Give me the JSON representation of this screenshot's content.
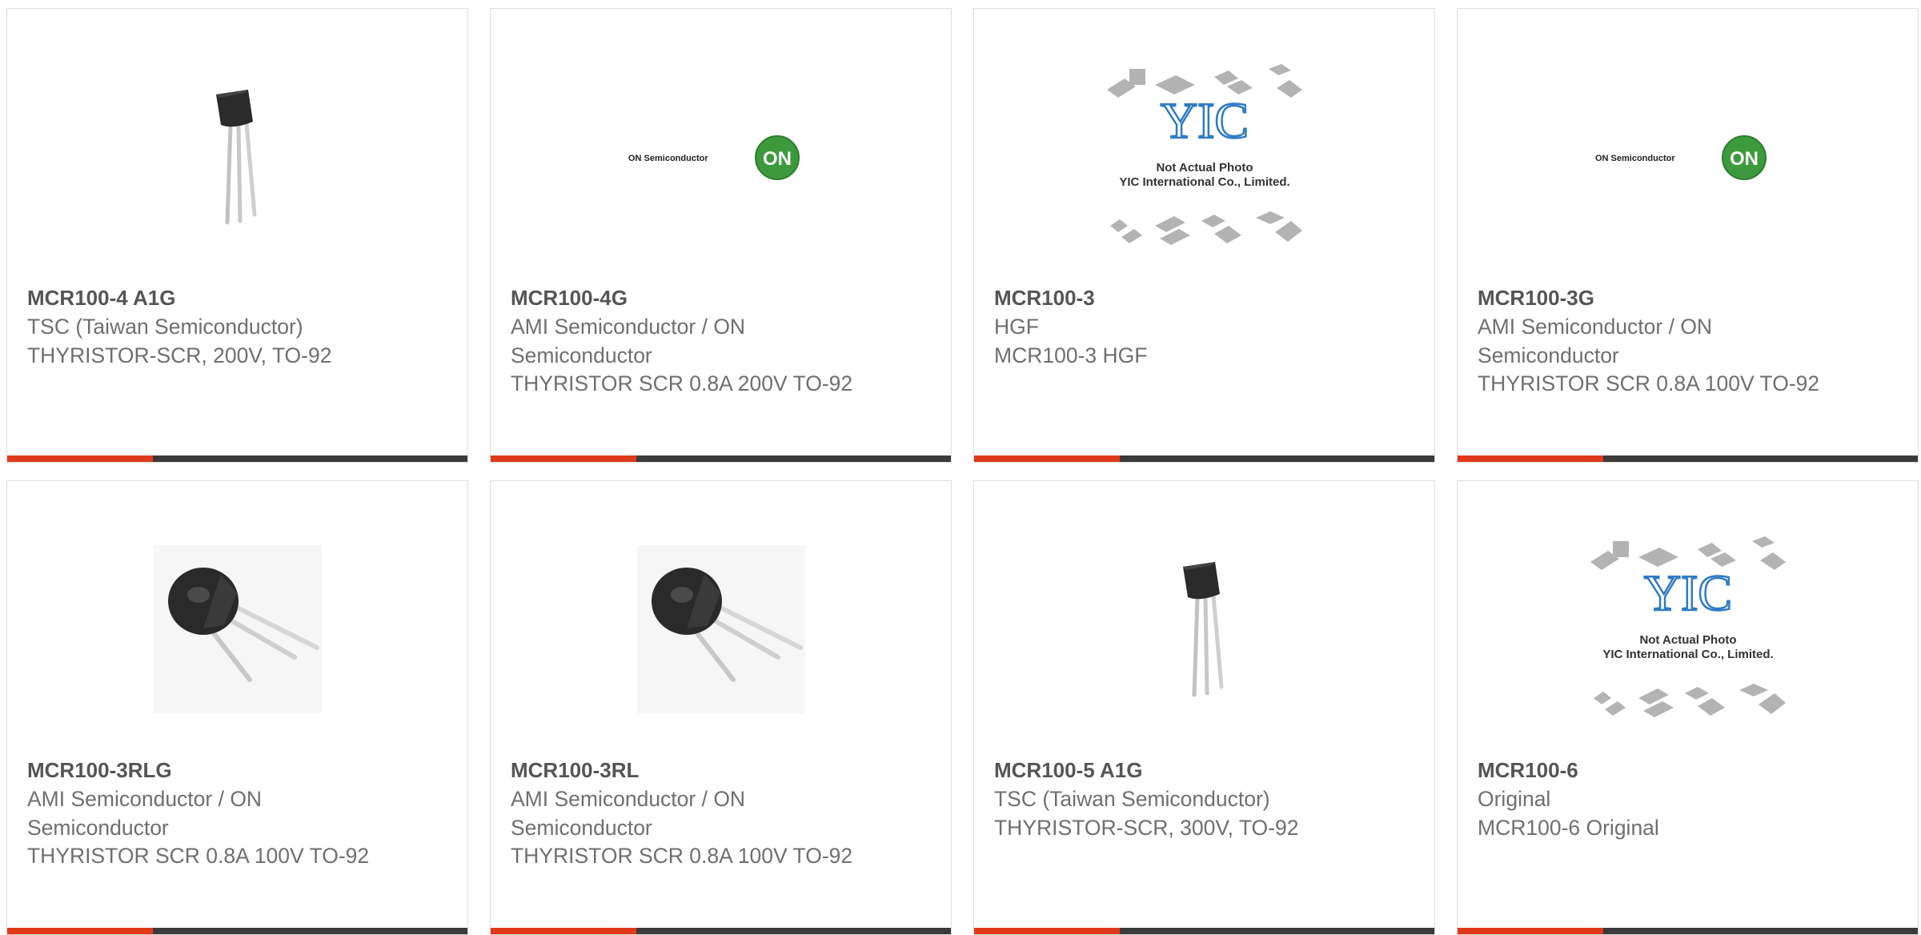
{
  "products": [
    {
      "part": "MCR100-4 A1G",
      "manufacturer": "TSC (Taiwan Semiconductor)",
      "description": "THYRISTOR-SCR, 200V, TO-92",
      "image": "to92-vertical-icon"
    },
    {
      "part": "MCR100-4G",
      "manufacturer": "AMI Semiconductor / ON Semiconductor",
      "description": "THYRISTOR SCR 0.8A 200V TO-92",
      "image": "on-semiconductor-logo"
    },
    {
      "part": "MCR100-3",
      "manufacturer": "HGF",
      "description": "MCR100-3 HGF",
      "image": "yic-placeholder"
    },
    {
      "part": "MCR100-3G",
      "manufacturer": "AMI Semiconductor / ON Semiconductor",
      "description": "THYRISTOR SCR 0.8A 100V TO-92",
      "image": "on-semiconductor-logo"
    },
    {
      "part": "MCR100-3RLG",
      "manufacturer": "AMI Semiconductor / ON Semiconductor",
      "description": "THYRISTOR SCR 0.8A 100V TO-92",
      "image": "to92-angled-icon"
    },
    {
      "part": "MCR100-3RL",
      "manufacturer": "AMI Semiconductor / ON Semiconductor",
      "description": "THYRISTOR SCR 0.8A 100V TO-92",
      "image": "to92-angled-icon"
    },
    {
      "part": "MCR100-5 A1G",
      "manufacturer": "TSC (Taiwan Semiconductor)",
      "description": "THYRISTOR-SCR, 300V, TO-92",
      "image": "to92-vertical-icon"
    },
    {
      "part": "MCR100-6",
      "manufacturer": "Original",
      "description": "MCR100-6 Original",
      "image": "yic-placeholder"
    }
  ],
  "logo_texts": {
    "on_brand": "ON Semiconductor",
    "on_mark": "ON",
    "yic_brand": "YIC",
    "yic_line1": "Not Actual Photo",
    "yic_line2": "YIC International Co., Limited."
  },
  "colors": {
    "accent": "#e0391a",
    "bar": "#3a3a3a",
    "title": "#555555",
    "text": "#6f6f6f",
    "on_green": "#3c9a3c",
    "yic_blue": "#2e7bc4"
  }
}
